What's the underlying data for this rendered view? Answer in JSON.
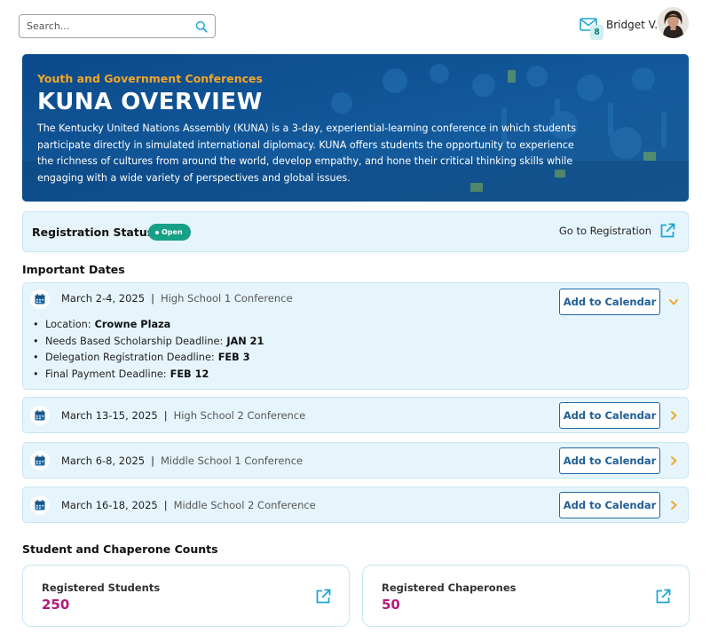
{
  "search": {
    "placeholder": "Search..."
  },
  "user": {
    "name": "Bridget V.",
    "mail_count": "8"
  },
  "hero": {
    "eyebrow": "Youth and Government Conferences",
    "title": "KUNA OVERVIEW",
    "description": "The Kentucky United Nations Assembly (KUNA) is a 3-day, experiential-learning conference in which students participate directly in simulated international diplomacy. KUNA offers students the opportunity to experience the richness of cultures from around the world, develop empathy, and hone their critical thinking skills while engaging with a wide variety of perspectives and global issues."
  },
  "registration": {
    "title": "Registration Status",
    "status": "Open",
    "link_label": "Go to Registration"
  },
  "important_dates": {
    "heading": "Important Dates",
    "add_label": "Add to Calendar",
    "items": [
      {
        "date": "March 2-4, 2025",
        "conference": "High School 1 Conference",
        "expanded": true,
        "details": [
          {
            "label": "Location:",
            "value": "Crowne Plaza"
          },
          {
            "label": "Needs Based Scholarship Deadline:",
            "value": "JAN 21"
          },
          {
            "label": "Delegation Registration Deadline:",
            "value": "FEB 3"
          },
          {
            "label": "Final Payment Deadline:",
            "value": "FEB 12"
          }
        ]
      },
      {
        "date": "March 13-15, 2025",
        "conference": "High School 2 Conference",
        "expanded": false
      },
      {
        "date": "March 6-8, 2025",
        "conference": "Middle School 1 Conference",
        "expanded": false
      },
      {
        "date": "March 16-18, 2025",
        "conference": "Middle School 2 Conference",
        "expanded": false
      }
    ]
  },
  "counts": {
    "heading": "Student and Chaperone Counts",
    "students": {
      "label": "Registered Students",
      "value": "250"
    },
    "chaperones": {
      "label": "Registered Chaperones",
      "value": "50"
    }
  },
  "colors": {
    "accent_orange": "#f3a62b",
    "primary_blue": "#1f5e96",
    "card_bg": "#e6f5fb",
    "status_green": "#16a085",
    "count_magenta": "#b5197e",
    "icon_cyan": "#1ea6d6"
  },
  "icons": {
    "search": "search-icon",
    "mail": "mail-icon",
    "calendar": "calendar-icon",
    "external_link": "external-link-icon",
    "chevron_down": "chevron-down-icon",
    "chevron_right": "chevron-right-icon"
  }
}
